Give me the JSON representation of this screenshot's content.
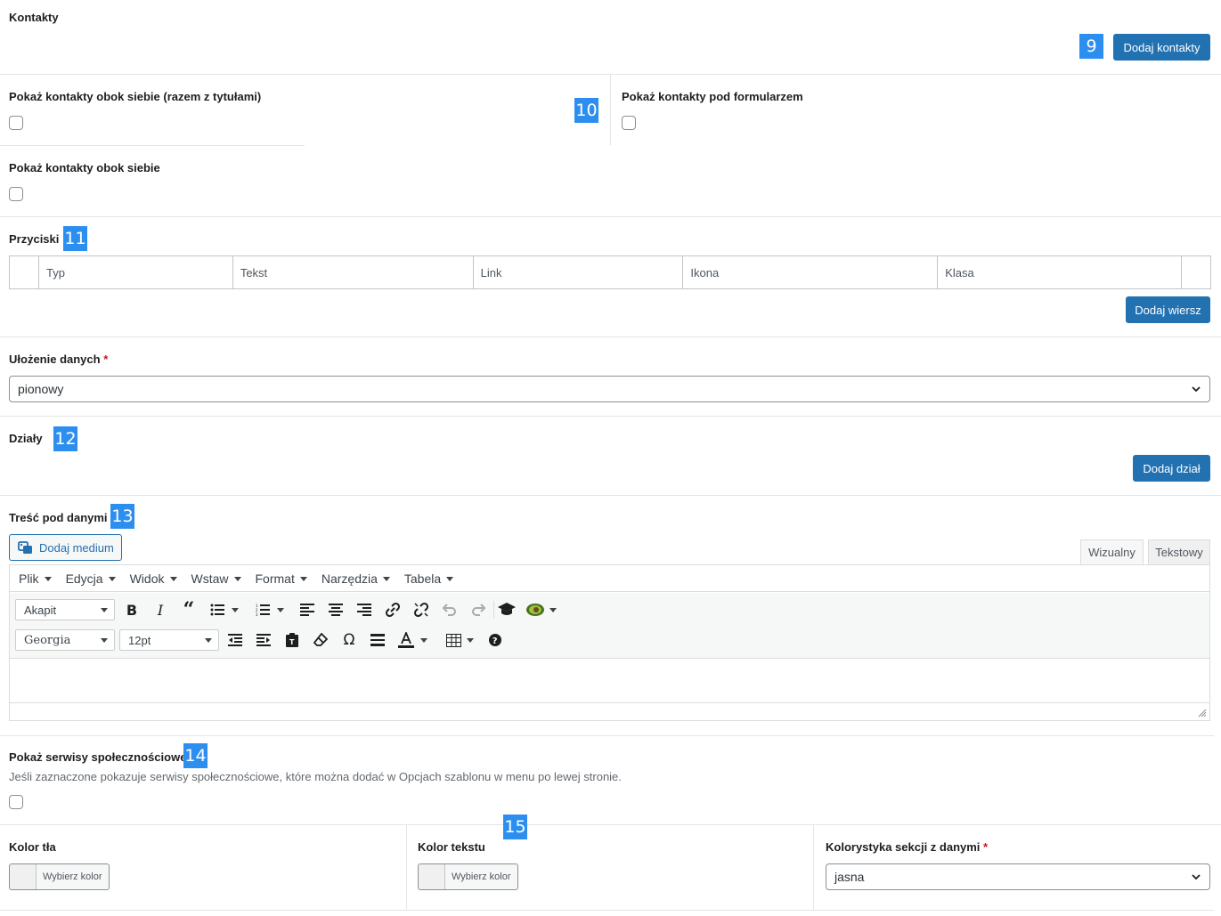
{
  "contacts": {
    "label": "Kontakty",
    "badge": "9",
    "add_button": "Dodaj kontakty"
  },
  "options": {
    "badge": "10",
    "side_with_titles": "Pokaż kontakty obok siebie (razem z tytułami)",
    "under_form": "Pokaż kontakty pod formularzem",
    "side_by_side": "Pokaż kontakty obok siebie"
  },
  "buttons_section": {
    "label": "Przyciski",
    "badge": "11",
    "columns": [
      "Typ",
      "Tekst",
      "Link",
      "Ikona",
      "Klasa"
    ],
    "add_row": "Dodaj wiersz"
  },
  "layout": {
    "label": "Ułożenie danych",
    "required": "*",
    "value": "pionowy"
  },
  "departments": {
    "label": "Działy",
    "badge": "12",
    "add_button": "Dodaj dział"
  },
  "content": {
    "label": "Treść pod danymi",
    "badge": "13",
    "add_media": "Dodaj medium",
    "tab_visual": "Wizualny",
    "tab_text": "Tekstowy",
    "menu": [
      "Plik",
      "Edycja",
      "Widok",
      "Wstaw",
      "Format",
      "Narzędzia",
      "Tabela"
    ],
    "paragraph_select": "Akapit",
    "font_select": "Georgia",
    "size_select": "12pt"
  },
  "social": {
    "label": "Pokaż serwisy społecznościowe",
    "badge": "14",
    "help": "Jeśli zaznaczone pokazuje serwisy społecznościowe, które można dodać w Opcjach szablonu w menu po lewej stronie."
  },
  "colors": {
    "badge": "15",
    "bg_label": "Kolor tła",
    "text_label": "Kolor tekstu",
    "pick": "Wybierz kolor",
    "scheme_label": "Kolorystyka sekcji z danymi",
    "scheme_required": "*",
    "scheme_value": "jasna"
  },
  "theme": {
    "primary": "#2271b1",
    "badge": "#2c8ff0"
  }
}
